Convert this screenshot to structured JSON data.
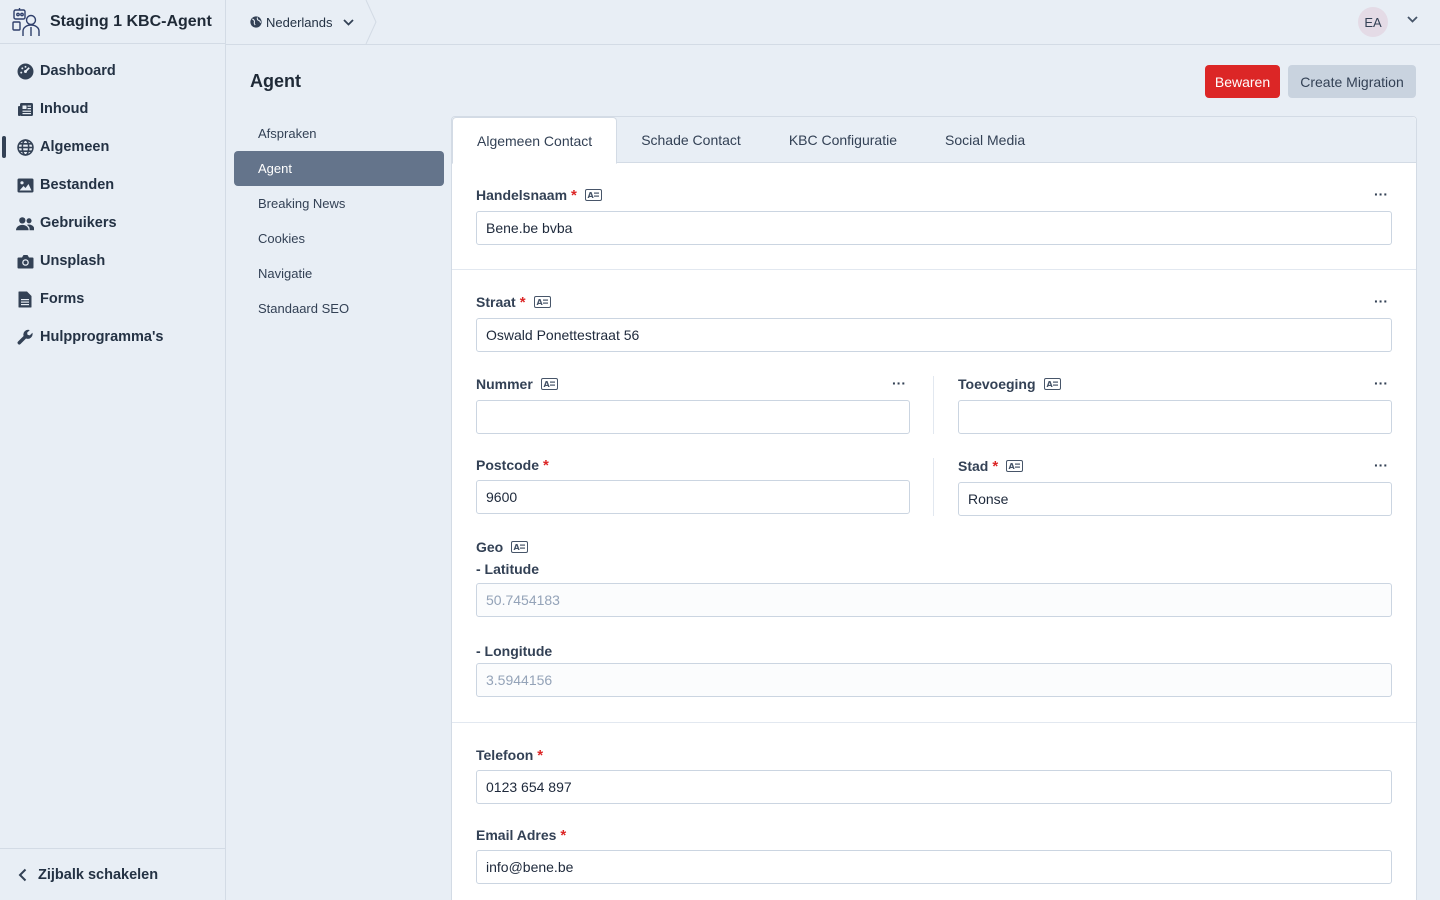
{
  "app": {
    "title": "Staging 1 KBC-Agent",
    "logo_icon": "agent-robot-logo"
  },
  "sidebar": {
    "items": [
      {
        "label": "Dashboard",
        "icon": "dashboard-icon"
      },
      {
        "label": "Inhoud",
        "icon": "newspaper-icon"
      },
      {
        "label": "Algemeen",
        "icon": "globe-icon",
        "active": true
      },
      {
        "label": "Bestanden",
        "icon": "image-icon"
      },
      {
        "label": "Gebruikers",
        "icon": "users-icon"
      },
      {
        "label": "Unsplash",
        "icon": "camera-icon"
      },
      {
        "label": "Forms",
        "icon": "file-icon"
      },
      {
        "label": "Hulpprogramma's",
        "icon": "wrench-icon"
      }
    ],
    "footer_label": "Zijbalk schakelen"
  },
  "topbar": {
    "language": "Nederlands",
    "avatar_initials": "EA"
  },
  "page": {
    "title": "Agent",
    "save_label": "Bewaren",
    "migration_label": "Create Migration"
  },
  "subnav": {
    "items": [
      "Afspraken",
      "Agent",
      "Breaking News",
      "Cookies",
      "Navigatie",
      "Standaard SEO"
    ],
    "active": "Agent"
  },
  "tabs": [
    "Algemeen Contact",
    "Schade Contact",
    "KBC Configuratie",
    "Social Media"
  ],
  "form": {
    "handelsnaam": {
      "label": "Handelsnaam",
      "value": "Bene.be bvba"
    },
    "straat": {
      "label": "Straat",
      "value": "Oswald Ponettestraat 56"
    },
    "nummer": {
      "label": "Nummer",
      "value": ""
    },
    "toevoeging": {
      "label": "Toevoeging",
      "value": ""
    },
    "postcode": {
      "label": "Postcode",
      "value": "9600"
    },
    "stad": {
      "label": "Stad",
      "value": "Ronse"
    },
    "geo": {
      "label": "Geo",
      "lat_label": "- Latitude",
      "lat_value": "50.7454183",
      "lng_label": "- Longitude",
      "lng_value": "3.5944156"
    },
    "telefoon": {
      "label": "Telefoon",
      "value": "0123 654 897"
    },
    "email": {
      "label": "Email Adres",
      "value": "info@bene.be"
    },
    "more_glyph": "···",
    "required_glyph": "*"
  },
  "colors": {
    "accent_red": "#dc2626",
    "sidebar_bg": "#e8eef5",
    "active_subnav": "#64748b"
  }
}
